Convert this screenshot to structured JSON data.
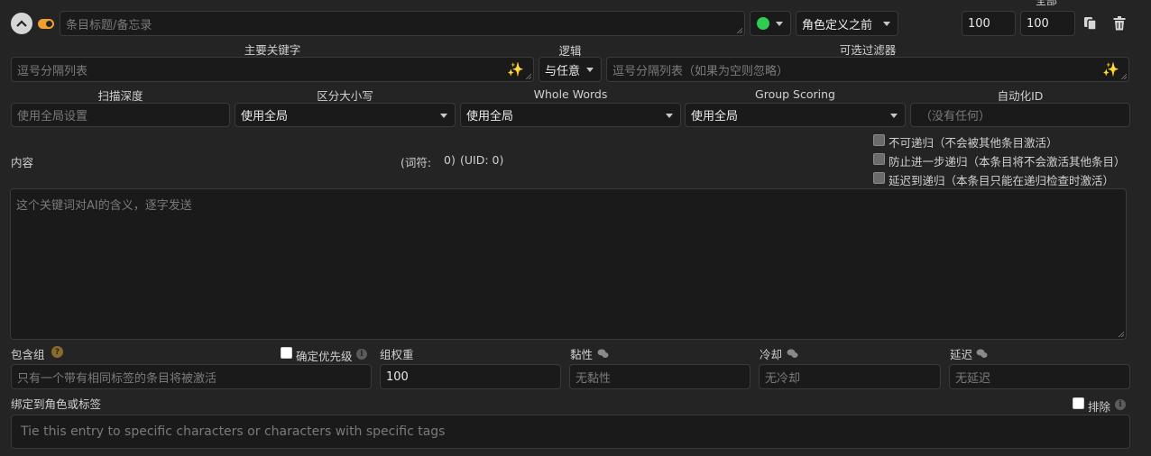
{
  "top_cut_label": "全部",
  "header": {
    "title_placeholder": "条目标题/备忘录",
    "position_value": "角色定义之前",
    "order_value": "100",
    "probability_value": "100"
  },
  "row_keys": {
    "primary_label": "主要关键字",
    "primary_placeholder": "逗号分隔列表",
    "logic_label": "逻辑",
    "logic_value": "与任意",
    "filter_label": "可选过滤器",
    "filter_placeholder": "逗号分隔列表（如果为空则忽略）"
  },
  "row_scan": {
    "depth_label": "扫描深度",
    "depth_placeholder": "使用全局设置",
    "case_label": "区分大小写",
    "case_value": "使用全局",
    "whole_label": "Whole Words",
    "whole_value": "使用全局",
    "group_scoring_label": "Group Scoring",
    "group_scoring_value": "使用全局",
    "automation_label": "自动化ID",
    "automation_placeholder": "（没有任何）"
  },
  "content": {
    "label": "内容",
    "tokens_label": "(词符:",
    "tokens_value": "0)",
    "uid_text": "(UID: 0)",
    "placeholder": "这个关键词对AI的含义，逐字发送",
    "options": [
      "不可递归（不会被其他条目激活）",
      "防止进一步递归（本条目将不会激活其他条目）",
      "延迟到递归（本条目只能在递归检查时激活）"
    ]
  },
  "group": {
    "label": "包含组",
    "help": "?",
    "prioritize_label": "确定优先级",
    "placeholder": "只有一个带有相同标签的条目将被激活",
    "weight_label": "组权重",
    "weight_value": "100",
    "sticky_label": "黏性",
    "sticky_placeholder": "无黏性",
    "cooldown_label": "冷却",
    "cooldown_placeholder": "无冷却",
    "delay_label": "延迟",
    "delay_placeholder": "无延迟"
  },
  "bind": {
    "label": "绑定到角色或标签",
    "exclude_label": "排除",
    "placeholder": "Tie this entry to specific characters or characters with specific tags"
  },
  "colors": {
    "background": "#242424",
    "input_bg": "#1a1a1a",
    "status_green": "#2ecc52",
    "toggle_orange": "#f0a030",
    "sparkle": "#d6b25c"
  }
}
